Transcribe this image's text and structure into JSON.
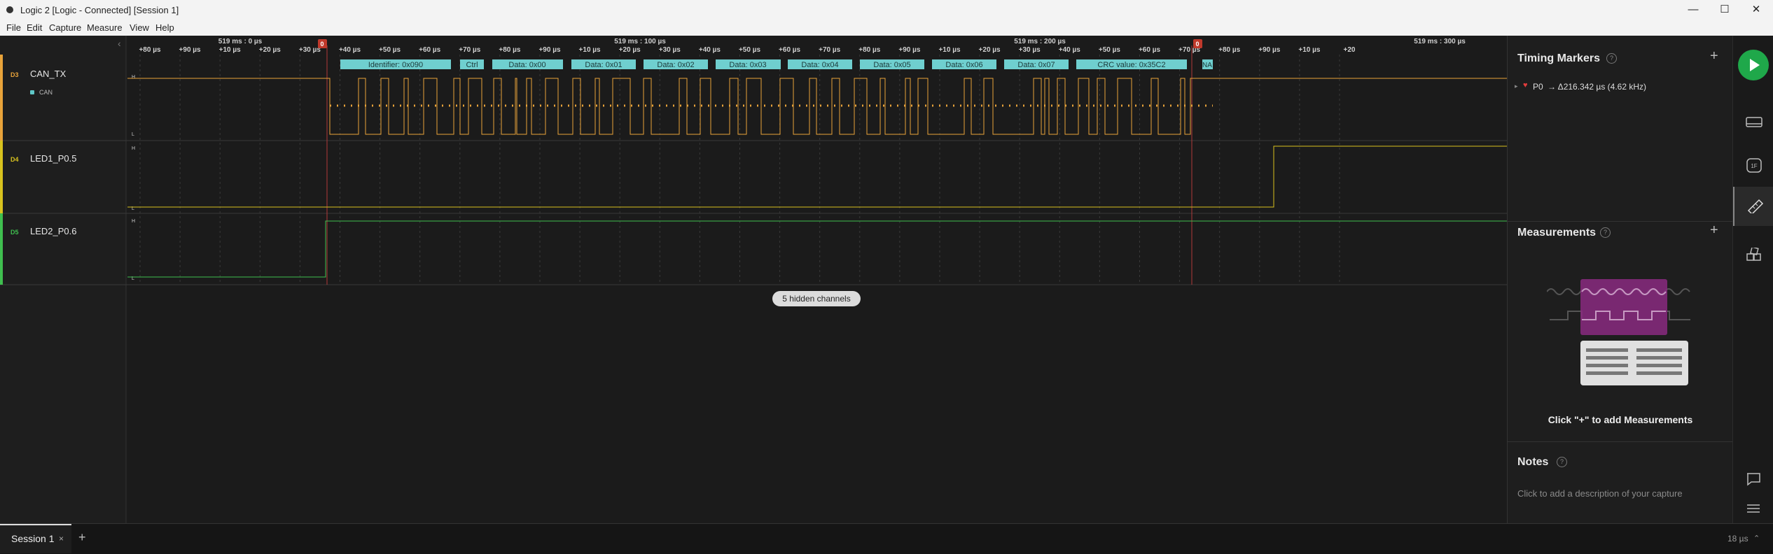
{
  "window": {
    "title": "Logic 2 [Logic - Connected] [Session 1]",
    "controls": {
      "minimize": "—",
      "maximize": "☐",
      "close": "✕"
    }
  },
  "menu": [
    "File",
    "Edit",
    "Capture",
    "Measure",
    "View",
    "Help"
  ],
  "timeline": {
    "major_labels": [
      "519 ms : 0 µs",
      "519 ms : 100 µs",
      "519 ms : 200 µs",
      "519 ms : 300 µs"
    ],
    "ticks": [
      "+80 µs",
      "+90 µs",
      "+10 µs",
      "+20 µs",
      "+30 µs",
      "+40 µs",
      "+50 µs",
      "+60 µs",
      "+70 µs",
      "+80 µs",
      "+90 µs",
      "+10 µs",
      "+20 µs",
      "+30 µs",
      "+40 µs",
      "+50 µs",
      "+60 µs",
      "+70 µs",
      "+80 µs",
      "+90 µs",
      "+10 µs",
      "+20 µs",
      "+30 µs",
      "+40 µs",
      "+50 µs",
      "+60 µs",
      "+70 µs",
      "+80 µs",
      "+90 µs",
      "+10 µs",
      "+20"
    ],
    "marker_label": "0",
    "collapse_glyph": "‹"
  },
  "channels": [
    {
      "id": "D3",
      "name": "CAN_TX",
      "color": "#e8a33a",
      "analyzer": "CAN",
      "analyzer_color": "#5fc7c7",
      "high": "H",
      "low": "L"
    },
    {
      "id": "D4",
      "name": "LED1_P0.5",
      "color": "#d8c21e",
      "high": "H",
      "low": "L"
    },
    {
      "id": "D5",
      "name": "LED2_P0.6",
      "color": "#3fbf4f",
      "high": "H",
      "low": "L"
    }
  ],
  "decoder_frames": [
    "Identifier: 0x090",
    "Ctrl",
    "Data: 0x00",
    "Data: 0x01",
    "Data: 0x02",
    "Data: 0x03",
    "Data: 0x04",
    "Data: 0x05",
    "Data: 0x06",
    "Data: 0x07",
    "CRC value: 0x35C2",
    "NA"
  ],
  "hidden_channels_label": "5 hidden channels",
  "timing_markers": {
    "title": "Timing Markers",
    "help": "?",
    "add": "+",
    "marker": {
      "arrow": "▸",
      "name": "P0",
      "value": "→  Δ216.342 µs (4.62 kHz)"
    }
  },
  "measurements": {
    "title": "Measurements",
    "help": "?",
    "add": "+",
    "hint": "Click \"+\" to add Measurements"
  },
  "notes": {
    "title": "Notes",
    "help": "?",
    "placeholder": "Click to add a description of your capture"
  },
  "session": {
    "tab": "Session 1",
    "close": "×",
    "add": "+"
  },
  "status": {
    "scale": "18 µs",
    "chevron": "⌃"
  },
  "colors": {
    "background": "#1b1b1b",
    "can_channel": "#e8a33a",
    "led1_channel": "#d8c21e",
    "led2_channel": "#3fbf4f",
    "decoder_box": "#6fcfcf",
    "marker": "#c0392b",
    "run_button": "#1fa84a"
  },
  "icons": [
    "run-icon",
    "device-icon",
    "analyzer-icon",
    "measure-icon",
    "extensions-icon",
    "chat-icon",
    "menu-icon"
  ]
}
